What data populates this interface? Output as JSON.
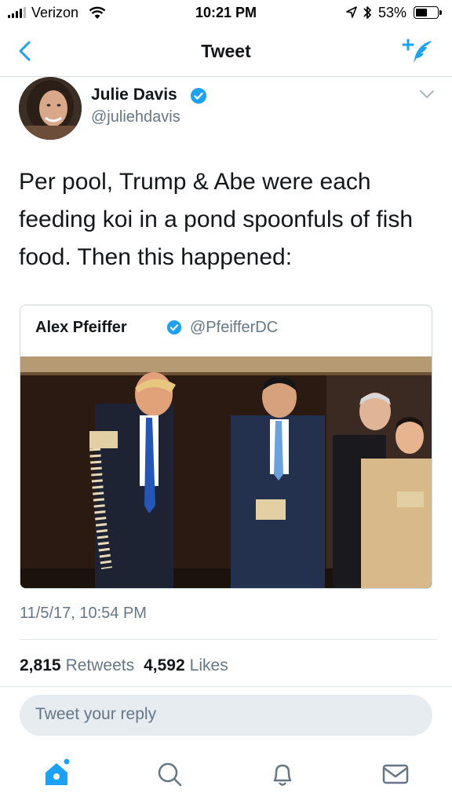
{
  "status_bar": {
    "carrier": "Verizon",
    "time": "10:21 PM",
    "battery": "53%",
    "battery_level": 0.53
  },
  "nav": {
    "title": "Tweet",
    "back_icon": "chevron-left-icon",
    "compose_icon": "compose-tweet-icon"
  },
  "tweet": {
    "author_name": "Julie Davis",
    "author_handle": "@juliehdavis",
    "text": "Per pool, Trump & Abe were each feeding koi in a pond spoonfuls of fish food. Then this happened:",
    "timestamp": "11/5/17, 10:54 PM",
    "retweets_count": "2,815",
    "retweets_label": "Retweets",
    "likes_count": "4,592",
    "likes_label": "Likes"
  },
  "quoted_tweet": {
    "author_name": "Alex Pfeiffer",
    "author_handle": "@PfeifferDC"
  },
  "reply": {
    "placeholder": "Tweet your reply"
  },
  "tabbar": {
    "items": [
      "home-icon",
      "search-icon",
      "notifications-icon",
      "messages-icon"
    ]
  },
  "colors": {
    "brand": "#1da1f2",
    "secondary_text": "#657786",
    "primary_text": "#14171a"
  }
}
